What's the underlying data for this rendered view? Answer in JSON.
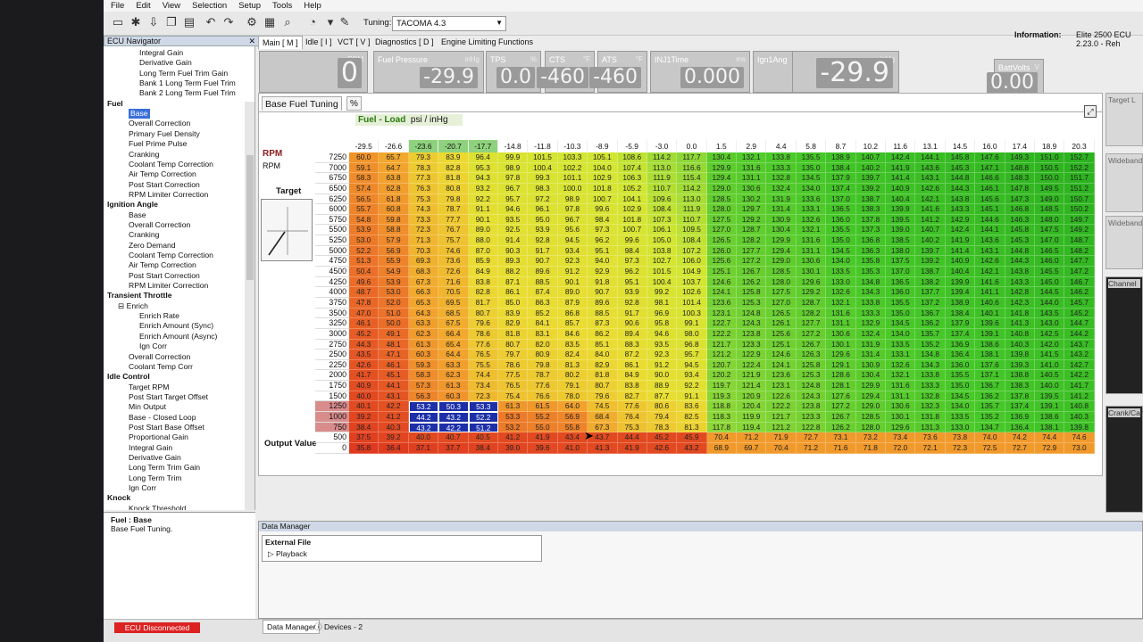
{
  "menu": [
    "File",
    "Edit",
    "View",
    "Selection",
    "Setup",
    "Tools",
    "Help"
  ],
  "toolbar": {
    "tuning_label": "Tuning:",
    "tuning_value": "TACOMA 4.3"
  },
  "info": {
    "label": "Information:",
    "value": "Elite 2500 ECU 2.23.0 - Reh"
  },
  "navigator": {
    "title": "ECU Navigator",
    "items": [
      {
        "label": "Integral Gain",
        "indent": 3
      },
      {
        "label": "Derivative Gain",
        "indent": 3
      },
      {
        "label": "Long Term Fuel Trim Gain",
        "indent": 3
      },
      {
        "label": "Bank 1 Long Term Fuel Trim",
        "indent": 3
      },
      {
        "label": "Bank 2 Long Term Fuel Trim",
        "indent": 3
      },
      {
        "label": "Fuel",
        "indent": 0,
        "bold": true
      },
      {
        "label": "Base",
        "indent": 2,
        "selected": true
      },
      {
        "label": "Overall Correction",
        "indent": 2
      },
      {
        "label": "Primary Fuel Density",
        "indent": 2
      },
      {
        "label": "Fuel Prime Pulse",
        "indent": 2
      },
      {
        "label": "Cranking",
        "indent": 2
      },
      {
        "label": "Coolant Temp Correction",
        "indent": 2
      },
      {
        "label": "Air Temp Correction",
        "indent": 2
      },
      {
        "label": "Post Start Correction",
        "indent": 2
      },
      {
        "label": "RPM Limiter Correction",
        "indent": 2
      },
      {
        "label": "Ignition Angle",
        "indent": 0,
        "bold": true
      },
      {
        "label": "Base",
        "indent": 2
      },
      {
        "label": "Overall Correction",
        "indent": 2
      },
      {
        "label": "Cranking",
        "indent": 2
      },
      {
        "label": "Zero Demand",
        "indent": 2
      },
      {
        "label": "Coolant Temp Correction",
        "indent": 2
      },
      {
        "label": "Air Temp Correction",
        "indent": 2
      },
      {
        "label": "Post Start Correction",
        "indent": 2
      },
      {
        "label": "RPM Limiter Correction",
        "indent": 2
      },
      {
        "label": "Transient Throttle",
        "indent": 0,
        "bold": true
      },
      {
        "label": "⊟ Enrich",
        "indent": 1
      },
      {
        "label": "Enrich Rate",
        "indent": 3
      },
      {
        "label": "Enrich Amount (Sync)",
        "indent": 3
      },
      {
        "label": "Enrich Amount (Async)",
        "indent": 3
      },
      {
        "label": "Ign Corr",
        "indent": 3
      },
      {
        "label": "Overall Correction",
        "indent": 2
      },
      {
        "label": "Coolant Temp Corr",
        "indent": 2
      },
      {
        "label": "Idle Control",
        "indent": 0,
        "bold": true
      },
      {
        "label": "Target RPM",
        "indent": 2
      },
      {
        "label": "Post Start Target Offset",
        "indent": 2
      },
      {
        "label": "Min Output",
        "indent": 2
      },
      {
        "label": "Base - Closed Loop",
        "indent": 2
      },
      {
        "label": "Post Start Base Offset",
        "indent": 2
      },
      {
        "label": "Proportional Gain",
        "indent": 2
      },
      {
        "label": "Integral Gain",
        "indent": 2
      },
      {
        "label": "Derivative Gain",
        "indent": 2
      },
      {
        "label": "Long Term Trim Gain",
        "indent": 2
      },
      {
        "label": "Long Term Trim",
        "indent": 2
      },
      {
        "label": "Ign Corr",
        "indent": 2
      },
      {
        "label": "Knock",
        "indent": 0,
        "bold": true
      },
      {
        "label": "Knock Threshold",
        "indent": 2
      }
    ]
  },
  "description": {
    "title": "Fuel : Base",
    "text": "Base Fuel Tuning."
  },
  "tabs": [
    "Main [ M ]",
    "Idle [ I ]",
    "VCT [ V ]",
    "Diagnostics [ D ]",
    "Engine Limiting Functions"
  ],
  "gauges": [
    {
      "label": "",
      "unit": "RPM",
      "value": "0",
      "big": true
    },
    {
      "label": "Fuel Pressure",
      "unit": "inHg",
      "value": "-29.9"
    },
    {
      "label": "TPS",
      "unit": "%",
      "value": "0.0"
    },
    {
      "label": "CTS",
      "unit": "°F",
      "value": "-460"
    },
    {
      "label": "ATS",
      "unit": "°F",
      "value": "-460"
    },
    {
      "label": "INJ1Time",
      "unit": "ms",
      "value": "0.000"
    },
    {
      "label": "Ign1Ang",
      "unit": "°",
      "value": "0.0"
    },
    {
      "label": "",
      "unit": "inHg",
      "value": "-29.9",
      "big": true
    },
    {
      "label": "BattVolts",
      "unit": "V",
      "value": "0.00"
    }
  ],
  "tuning": {
    "tab_title": "Base Fuel Tuning",
    "tab_pct": "%",
    "map_title": "Fuel - Load",
    "map_unit": "psi / inHg",
    "rpm_label": "RPM",
    "rpm_sub": "RPM",
    "target_label": "Target",
    "output_label": "Output Value",
    "x_axis": [
      "-29.5",
      "-26.6",
      "-23.6",
      "-20.7",
      "-17.7",
      "-14.8",
      "-11.8",
      "-10.3",
      "-8.9",
      "-5.9",
      "-3.0",
      "0.0",
      "1.5",
      "2.9",
      "4.4",
      "5.8",
      "8.7",
      "10.2",
      "11.6",
      "13.1",
      "14.5",
      "16.0",
      "17.4",
      "18.9",
      "20.3"
    ],
    "x_highlight": [
      2,
      3,
      4
    ],
    "y_axis": [
      "7250",
      "7000",
      "6750",
      "6500",
      "6250",
      "6000",
      "5750",
      "5500",
      "5250",
      "5000",
      "4750",
      "4500",
      "4250",
      "4000",
      "3750",
      "3500",
      "3250",
      "3000",
      "2750",
      "2500",
      "2250",
      "2000",
      "1750",
      "1500",
      "1250",
      "1000",
      "750",
      "500",
      "0"
    ],
    "y_highlight": [
      24,
      25,
      26
    ],
    "table": [
      [
        "60.0",
        "65.7",
        "79.3",
        "83.9",
        "96.4",
        "99.9",
        "101.5",
        "103.3",
        "105.1",
        "108.6",
        "114.2",
        "117.7",
        "130.4",
        "132.1",
        "133.8",
        "135.5",
        "138.9",
        "140.7",
        "142.4",
        "144.1",
        "145.8",
        "147.6",
        "149.3",
        "151.0",
        "152.7"
      ],
      [
        "59.1",
        "64.7",
        "78.3",
        "82.8",
        "95.3",
        "98.9",
        "100.4",
        "102.2",
        "104.0",
        "107.4",
        "113.0",
        "116.6",
        "129.9",
        "131.6",
        "133.3",
        "135.0",
        "138.4",
        "140.2",
        "141.9",
        "143.6",
        "145.3",
        "147.1",
        "148.8",
        "150.5",
        "152.2"
      ],
      [
        "58.3",
        "63.8",
        "77.3",
        "81.8",
        "94.3",
        "97.8",
        "99.3",
        "101.1",
        "102.9",
        "106.3",
        "111.9",
        "115.4",
        "129.4",
        "131.1",
        "132.8",
        "134.5",
        "137.9",
        "139.7",
        "141.4",
        "143.1",
        "144.8",
        "146.6",
        "148.3",
        "150.0",
        "151.7"
      ],
      [
        "57.4",
        "62.8",
        "76.3",
        "80.8",
        "93.2",
        "96.7",
        "98.3",
        "100.0",
        "101.8",
        "105.2",
        "110.7",
        "114.2",
        "129.0",
        "130.6",
        "132.4",
        "134.0",
        "137.4",
        "139.2",
        "140.9",
        "142.6",
        "144.3",
        "146.1",
        "147.8",
        "149.5",
        "151.2"
      ],
      [
        "56.5",
        "61.8",
        "75.3",
        "79.8",
        "92.2",
        "95.7",
        "97.2",
        "98.9",
        "100.7",
        "104.1",
        "109.6",
        "113.0",
        "128.5",
        "130.2",
        "131.9",
        "133.6",
        "137.0",
        "138.7",
        "140.4",
        "142.1",
        "143.8",
        "145.6",
        "147.3",
        "149.0",
        "150.7"
      ],
      [
        "55.7",
        "60.8",
        "74.3",
        "78.7",
        "91.1",
        "94.6",
        "96.1",
        "97.8",
        "99.6",
        "102.9",
        "108.4",
        "111.9",
        "128.0",
        "129.7",
        "131.4",
        "133.1",
        "136.5",
        "138.3",
        "139.9",
        "141.6",
        "143.3",
        "145.1",
        "146.8",
        "148.5",
        "150.2"
      ],
      [
        "54.8",
        "59.8",
        "73.3",
        "77.7",
        "90.1",
        "93.5",
        "95.0",
        "96.7",
        "98.4",
        "101.8",
        "107.3",
        "110.7",
        "127.5",
        "129.2",
        "130.9",
        "132.6",
        "136.0",
        "137.8",
        "139.5",
        "141.2",
        "142.9",
        "144.6",
        "146.3",
        "148.0",
        "149.7"
      ],
      [
        "53.9",
        "58.8",
        "72.3",
        "76.7",
        "89.0",
        "92.5",
        "93.9",
        "95.6",
        "97.3",
        "100.7",
        "106.1",
        "109.5",
        "127.0",
        "128.7",
        "130.4",
        "132.1",
        "135.5",
        "137.3",
        "139.0",
        "140.7",
        "142.4",
        "144.1",
        "145.8",
        "147.5",
        "149.2"
      ],
      [
        "53.0",
        "57.9",
        "71.3",
        "75.7",
        "88.0",
        "91.4",
        "92.8",
        "94.5",
        "96.2",
        "99.6",
        "105.0",
        "108.4",
        "126.5",
        "128.2",
        "129.9",
        "131.6",
        "135.0",
        "136.8",
        "138.5",
        "140.2",
        "141.9",
        "143.6",
        "145.3",
        "147.0",
        "148.7"
      ],
      [
        "52.2",
        "56.9",
        "70.3",
        "74.6",
        "87.0",
        "90.3",
        "91.7",
        "93.4",
        "95.1",
        "98.4",
        "103.8",
        "107.2",
        "126.0",
        "127.7",
        "129.4",
        "131.1",
        "134.5",
        "136.3",
        "138.0",
        "139.7",
        "141.4",
        "143.1",
        "144.8",
        "146.5",
        "148.2"
      ],
      [
        "51.3",
        "55.9",
        "69.3",
        "73.6",
        "85.9",
        "89.3",
        "90.7",
        "92.3",
        "94.0",
        "97.3",
        "102.7",
        "106.0",
        "125.6",
        "127.2",
        "129.0",
        "130.6",
        "134.0",
        "135.8",
        "137.5",
        "139.2",
        "140.9",
        "142.6",
        "144.3",
        "146.0",
        "147.7"
      ],
      [
        "50.4",
        "54.9",
        "68.3",
        "72.6",
        "84.9",
        "88.2",
        "89.6",
        "91.2",
        "92.9",
        "96.2",
        "101.5",
        "104.9",
        "125.1",
        "126.7",
        "128.5",
        "130.1",
        "133.5",
        "135.3",
        "137.0",
        "138.7",
        "140.4",
        "142.1",
        "143.8",
        "145.5",
        "147.2"
      ],
      [
        "49.6",
        "53.9",
        "67.3",
        "71.6",
        "83.8",
        "87.1",
        "88.5",
        "90.1",
        "91.8",
        "95.1",
        "100.4",
        "103.7",
        "124.6",
        "126.2",
        "128.0",
        "129.6",
        "133.0",
        "134.8",
        "136.5",
        "138.2",
        "139.9",
        "141.6",
        "143.3",
        "145.0",
        "146.7"
      ],
      [
        "48.7",
        "53.0",
        "66.3",
        "70.5",
        "82.8",
        "86.1",
        "87.4",
        "89.0",
        "90.7",
        "93.9",
        "99.2",
        "102.6",
        "124.1",
        "125.8",
        "127.5",
        "129.2",
        "132.6",
        "134.3",
        "136.0",
        "137.7",
        "139.4",
        "141.1",
        "142.8",
        "144.5",
        "146.2"
      ],
      [
        "47.8",
        "52.0",
        "65.3",
        "69.5",
        "81.7",
        "85.0",
        "86.3",
        "87.9",
        "89.6",
        "92.8",
        "98.1",
        "101.4",
        "123.6",
        "125.3",
        "127.0",
        "128.7",
        "132.1",
        "133.8",
        "135.5",
        "137.2",
        "138.9",
        "140.6",
        "142.3",
        "144.0",
        "145.7"
      ],
      [
        "47.0",
        "51.0",
        "64.3",
        "68.5",
        "80.7",
        "83.9",
        "85.2",
        "86.8",
        "88.5",
        "91.7",
        "96.9",
        "100.3",
        "123.1",
        "124.8",
        "126.5",
        "128.2",
        "131.6",
        "133.3",
        "135.0",
        "136.7",
        "138.4",
        "140.1",
        "141.8",
        "143.5",
        "145.2"
      ],
      [
        "46.1",
        "50.0",
        "63.3",
        "67.5",
        "79.6",
        "82.9",
        "84.1",
        "85.7",
        "87.3",
        "90.6",
        "95.8",
        "99.1",
        "122.7",
        "124.3",
        "126.1",
        "127.7",
        "131.1",
        "132.9",
        "134.5",
        "136.2",
        "137.9",
        "139.6",
        "141.3",
        "143.0",
        "144.7"
      ],
      [
        "45.2",
        "49.1",
        "62.3",
        "66.4",
        "78.6",
        "81.8",
        "83.1",
        "84.6",
        "86.2",
        "89.4",
        "94.6",
        "98.0",
        "122.2",
        "123.8",
        "125.6",
        "127.2",
        "130.6",
        "132.4",
        "134.0",
        "135.7",
        "137.4",
        "139.1",
        "140.8",
        "142.5",
        "144.2"
      ],
      [
        "44.3",
        "48.1",
        "61.3",
        "65.4",
        "77.6",
        "80.7",
        "82.0",
        "83.5",
        "85.1",
        "88.3",
        "93.5",
        "96.8",
        "121.7",
        "123.3",
        "125.1",
        "126.7",
        "130.1",
        "131.9",
        "133.5",
        "135.2",
        "136.9",
        "138.6",
        "140.3",
        "142.0",
        "143.7"
      ],
      [
        "43.5",
        "47.1",
        "60.3",
        "64.4",
        "76.5",
        "79.7",
        "80.9",
        "82.4",
        "84.0",
        "87.2",
        "92.3",
        "95.7",
        "121.2",
        "122.9",
        "124.6",
        "126.3",
        "129.6",
        "131.4",
        "133.1",
        "134.8",
        "136.4",
        "138.1",
        "139.8",
        "141.5",
        "143.2"
      ],
      [
        "42.6",
        "46.1",
        "59.3",
        "63.3",
        "75.5",
        "78.6",
        "79.8",
        "81.3",
        "82.9",
        "86.1",
        "91.2",
        "94.5",
        "120.7",
        "122.4",
        "124.1",
        "125.8",
        "129.1",
        "130.9",
        "132.6",
        "134.3",
        "136.0",
        "137.6",
        "139.3",
        "141.0",
        "142.7"
      ],
      [
        "41.7",
        "45.1",
        "58.3",
        "62.3",
        "74.4",
        "77.5",
        "78.7",
        "80.2",
        "81.8",
        "84.9",
        "90.0",
        "93.4",
        "120.2",
        "121.9",
        "123.6",
        "125.3",
        "128.6",
        "130.4",
        "132.1",
        "133.8",
        "135.5",
        "137.1",
        "138.8",
        "140.5",
        "142.2"
      ],
      [
        "40.9",
        "44.1",
        "57.3",
        "61.3",
        "73.4",
        "76.5",
        "77.6",
        "79.1",
        "80.7",
        "83.8",
        "88.9",
        "92.2",
        "119.7",
        "121.4",
        "123.1",
        "124.8",
        "128.1",
        "129.9",
        "131.6",
        "133.3",
        "135.0",
        "136.7",
        "138.3",
        "140.0",
        "141.7"
      ],
      [
        "40.0",
        "43.1",
        "56.3",
        "60.3",
        "72.3",
        "75.4",
        "76.6",
        "78.0",
        "79.6",
        "82.7",
        "87.7",
        "91.1",
        "119.3",
        "120.9",
        "122.6",
        "124.3",
        "127.6",
        "129.4",
        "131.1",
        "132.8",
        "134.5",
        "136.2",
        "137.8",
        "139.5",
        "141.2"
      ],
      [
        "40.1",
        "42.2",
        "53.2",
        "50.3",
        "53.3",
        "61.3",
        "61.5",
        "64.0",
        "74.5",
        "77.6",
        "80.6",
        "83.6",
        "118.8",
        "120.4",
        "122.2",
        "123.8",
        "127.2",
        "129.0",
        "130.6",
        "132.3",
        "134.0",
        "135.7",
        "137.4",
        "139.1",
        "140.8"
      ],
      [
        "39.2",
        "41.2",
        "44.2",
        "43.2",
        "52.2",
        "53.3",
        "55.2",
        "56.9",
        "68.4",
        "76.4",
        "79.4",
        "82.5",
        "118.3",
        "119.9",
        "121.7",
        "123.3",
        "126.7",
        "128.5",
        "130.1",
        "131.8",
        "133.5",
        "135.2",
        "136.9",
        "138.6",
        "140.3"
      ],
      [
        "38.4",
        "40.3",
        "43.2",
        "42.2",
        "51.2",
        "53.2",
        "55.0",
        "55.8",
        "67.3",
        "75.3",
        "78.3",
        "81.3",
        "117.8",
        "119.4",
        "121.2",
        "122.8",
        "126.2",
        "128.0",
        "129.6",
        "131.3",
        "133.0",
        "134.7",
        "136.4",
        "138.1",
        "139.8"
      ],
      [
        "37.5",
        "39.2",
        "40.0",
        "40.7",
        "40.5",
        "41.2",
        "41.9",
        "43.4",
        "43.7",
        "44.4",
        "45.2",
        "45.9",
        "70.4",
        "71.2",
        "71.9",
        "72.7",
        "73.1",
        "73.2",
        "73.4",
        "73.6",
        "73.8",
        "74.0",
        "74.2",
        "74.4",
        "74.6"
      ],
      [
        "35.8",
        "36.4",
        "37.1",
        "37.7",
        "38.4",
        "39.0",
        "39.6",
        "41.0",
        "41.3",
        "41.9",
        "42.6",
        "43.2",
        "68.9",
        "69.7",
        "70.4",
        "71.2",
        "71.6",
        "71.8",
        "72.0",
        "72.1",
        "72.3",
        "72.5",
        "72.7",
        "72.9",
        "73.0"
      ]
    ]
  },
  "data_manager": {
    "title": "Data Manager",
    "external": "External File",
    "playback": "Playback"
  },
  "status": {
    "ecu": "ECU Disconnected",
    "tab_dm": "Data Manager",
    "tab_dev": "Devices - 2"
  },
  "right_panels": [
    "Target L",
    "Wideband",
    "Wideband",
    "Channel",
    "Crank/Cam"
  ]
}
